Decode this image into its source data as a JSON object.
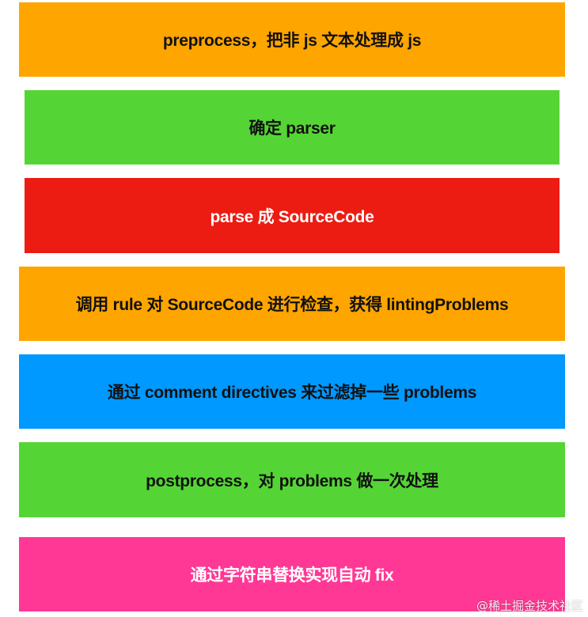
{
  "steps": [
    {
      "label": "preprocess，把非 js 文本处理成 js",
      "color": "#FFA500",
      "text_color": "#111111"
    },
    {
      "label": "确定 parser",
      "color": "#55D535",
      "text_color": "#111111"
    },
    {
      "label": "parse 成 SourceCode",
      "color": "#EC1C12",
      "text_color": "#FFFFFF"
    },
    {
      "label": "调用 rule 对 SourceCode 进行检查，获得 lintingProblems",
      "color": "#FFA500",
      "text_color": "#111111"
    },
    {
      "label": "通过 comment directives 来过滤掉一些 problems",
      "color": "#0099FF",
      "text_color": "#111111"
    },
    {
      "label": "postprocess，对 problems 做一次处理",
      "color": "#55D535",
      "text_color": "#111111"
    },
    {
      "label": "通过字符串替换实现自动 fix",
      "color": "#FF3895",
      "text_color": "#FFFFFF"
    }
  ],
  "watermark": "@稀土掘金技术社区"
}
